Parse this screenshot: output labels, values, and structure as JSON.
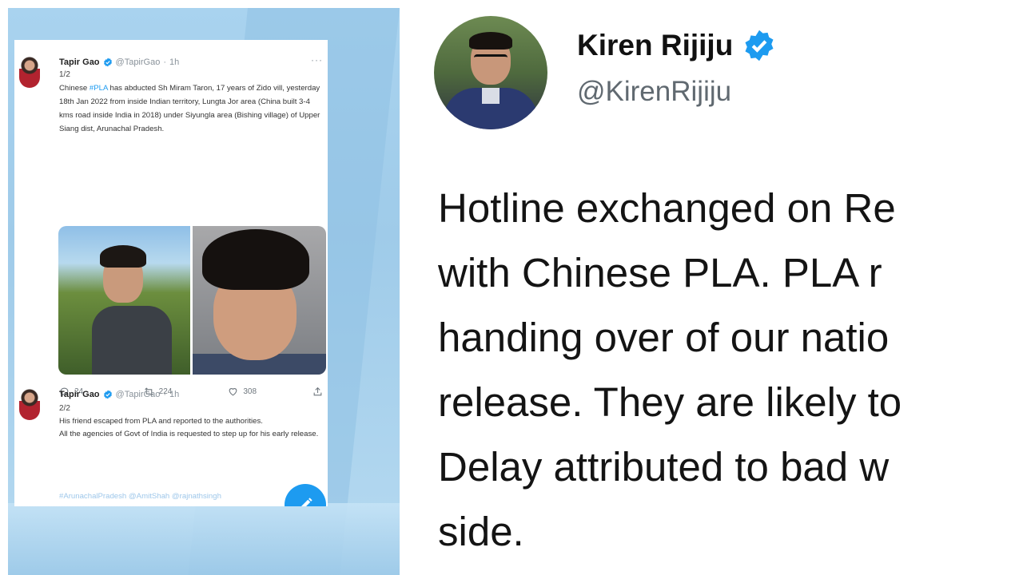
{
  "left_panel": {
    "tweet1": {
      "author": "Tapir Gao",
      "handle": "@TapirGao",
      "dot": "·",
      "time": "1h",
      "more": "···",
      "thread_count": "1/2",
      "body_pre": "Chinese ",
      "body_tag": "#PLA",
      "body_post": " has abducted Sh Miram Taron, 17 years of Zido vill, yesterday 18th Jan 2022 from inside Indian territory, Lungta Jor area (China built 3-4 kms road inside India in 2018) under Siyungla area (Bishing village) of Upper Siang dist, Arunachal Pradesh.",
      "replies": "24",
      "retweets": "224",
      "likes": "308"
    },
    "tweet2": {
      "author": "Tapir Gao",
      "handle": "@TapirGao",
      "dot": "·",
      "time": "1h",
      "thread_count": "2/2",
      "body_line1": "His friend escaped from PLA and reported to the authorities.",
      "body_line2": "All the agencies of Govt of India is requested to step up for his early release.",
      "faded_tags": "#ArunachalPradesh @AmitShah @rajnathsingh"
    }
  },
  "main_tweet": {
    "author": "Kiren Rijiju",
    "handle": "@KirenRijiju",
    "lines": [
      "Hotline exchanged on Re",
      "with Chinese PLA. PLA r",
      "handing over of our natio",
      "release. They are likely to",
      "Delay attributed to bad w",
      "side."
    ]
  },
  "colors": {
    "accent": "#1d9bf0",
    "background_panel": "#a9d3ef",
    "text_primary": "#141414",
    "text_secondary": "#606970"
  },
  "icons": [
    "verified-badge-icon",
    "reply-icon",
    "retweet-icon",
    "like-icon",
    "share-icon",
    "compose-icon",
    "more-icon"
  ]
}
